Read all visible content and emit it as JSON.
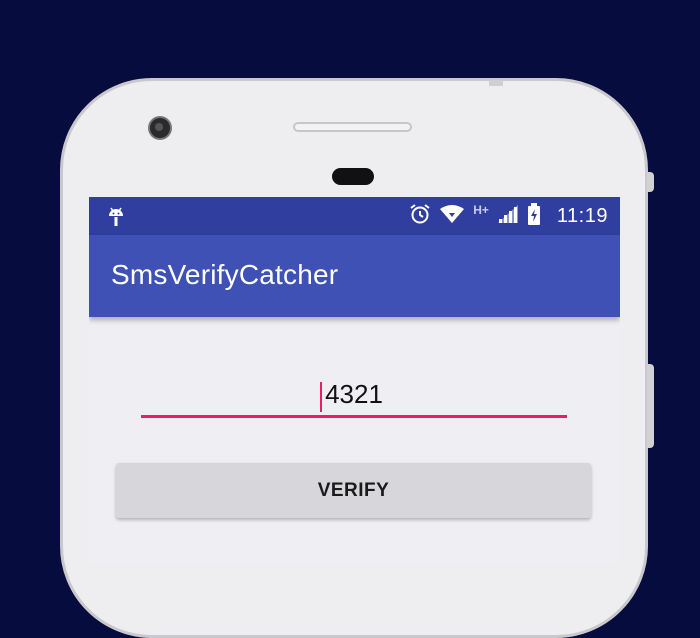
{
  "status_bar": {
    "time": "11:19",
    "network_type": "H+",
    "icons": [
      "android-debug-icon",
      "alarm-icon",
      "wifi-icon",
      "signal-icon",
      "battery-charging-icon"
    ]
  },
  "app_bar": {
    "title": "SmsVerifyCatcher"
  },
  "verification": {
    "code_value": "4321",
    "verify_label": "VERIFY"
  },
  "colors": {
    "background": "#070c3e",
    "status_bar": "#303f9f",
    "primary": "#3f51b5",
    "accent": "#e91e63",
    "button": "#d7d6da"
  }
}
